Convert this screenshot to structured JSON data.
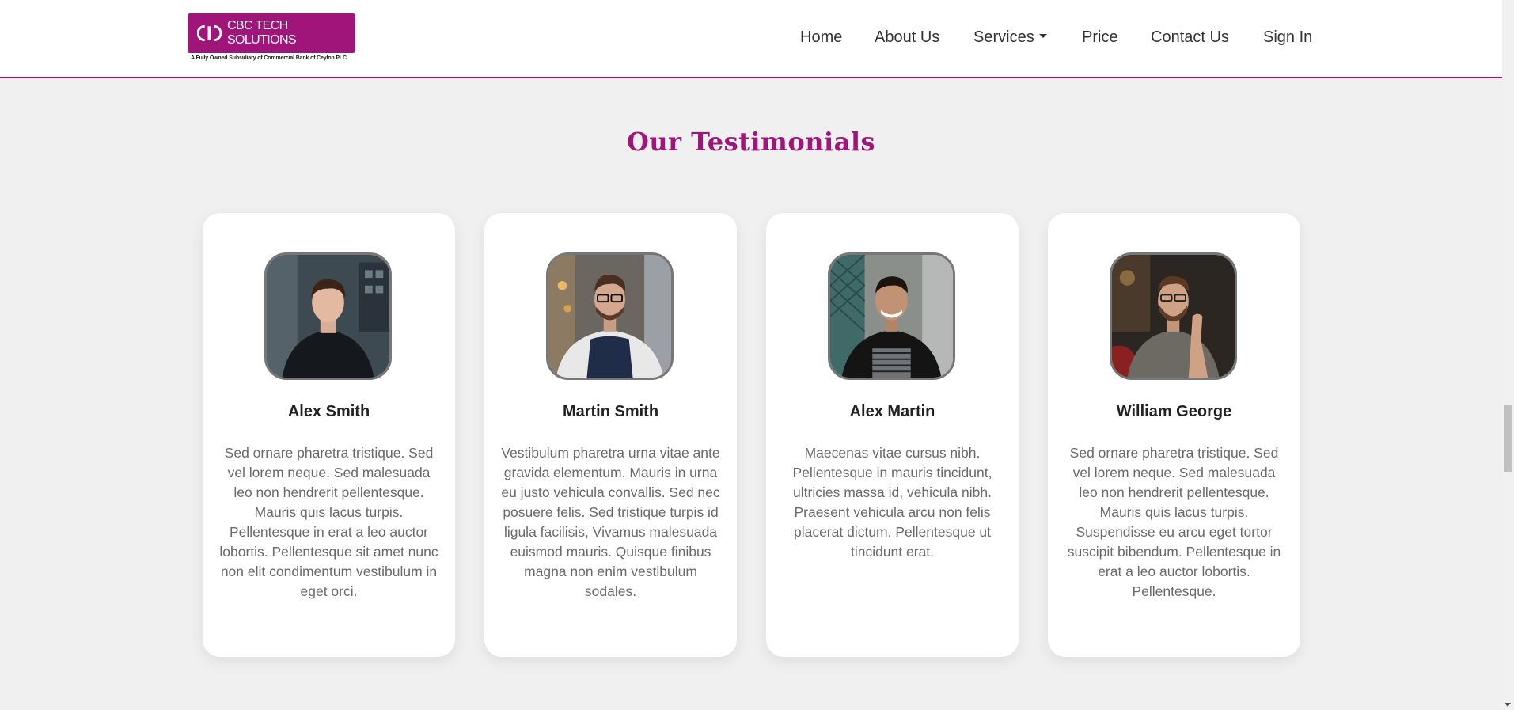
{
  "header": {
    "logo_text": "CBC TECH SOLUTIONS",
    "logo_subtitle": "A Fully Owned Subsidiary of Commercial Bank of Ceylon PLC",
    "nav": [
      {
        "label": "Home"
      },
      {
        "label": "About Us"
      },
      {
        "label": "Services"
      },
      {
        "label": "Price"
      },
      {
        "label": "Contact Us"
      },
      {
        "label": "Sign In"
      }
    ]
  },
  "section": {
    "title": "Our Testimonials"
  },
  "testimonials": [
    {
      "name": "Alex Smith",
      "text": "Sed ornare pharetra tristique. Sed vel lorem neque. Sed malesuada leo non hendrerit pellentesque. Mauris quis lacus turpis. Pellentesque in erat a leo auctor lobortis. Pellentesque sit amet nunc non elit condimentum vestibulum in eget orci."
    },
    {
      "name": "Martin Smith",
      "text": "Vestibulum pharetra urna vitae ante gravida elementum. Mauris in urna eu justo vehicula convallis. Sed nec posuere felis. Sed tristique turpis id ligula facilisis, Vivamus malesuada euismod mauris. Quisque finibus magna non enim vestibulum sodales."
    },
    {
      "name": "Alex Martin",
      "text": "Maecenas vitae cursus nibh. Pellentesque in mauris tincidunt, ultricies massa id, vehicula nibh. Praesent vehicula arcu non felis placerat dictum. Pellentesque ut tincidunt erat."
    },
    {
      "name": "William George",
      "text": "Sed ornare pharetra tristique. Sed vel lorem neque. Sed malesuada leo non hendrerit pellentesque. Mauris quis lacus turpis. Suspendisse eu arcu eget tortor suscipit bibendum. Pellentesque in erat a leo auctor lobortis. Pellentesque."
    }
  ],
  "colors": {
    "brand": "#a0157a",
    "background": "#f0f0f0",
    "card": "#ffffff",
    "nav_text": "#333333",
    "body_text": "#6a6a6a"
  },
  "icons": {
    "logo": "cbc-logo-icon",
    "services_dropdown": "caret-down-icon"
  }
}
